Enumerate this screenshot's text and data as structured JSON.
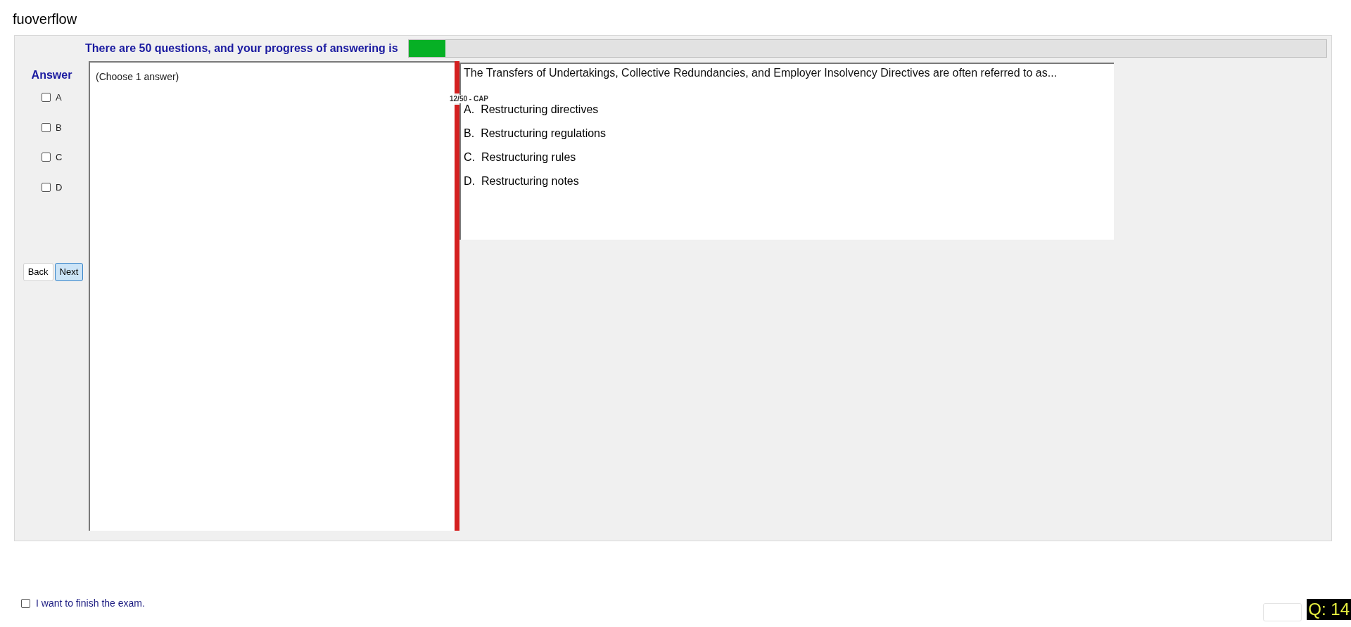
{
  "app_title": "fuoverflow",
  "progress": {
    "label": "There are 50 questions, and your progress of answering is",
    "level": 0.04
  },
  "answer_panel": {
    "title": "Answer",
    "options": [
      {
        "label": "A",
        "checked": false
      },
      {
        "label": "B",
        "checked": false
      },
      {
        "label": "C",
        "checked": false
      },
      {
        "label": "D",
        "checked": false
      }
    ]
  },
  "buttons": [
    {
      "label": "Back",
      "selected": false
    },
    {
      "label": "Next",
      "selected": true
    }
  ],
  "answer_hint": "(Choose 1 answer)",
  "question": {
    "tag": "12/50 - CAP",
    "text": "The Transfers of Undertakings, Collective Redundancies, and Employer Insolvency Directives are often referred to as...",
    "choices": [
      {
        "letter": "A.",
        "text": "Restructuring directives"
      },
      {
        "letter": "B.",
        "text": "Restructuring regulations"
      },
      {
        "letter": "C.",
        "text": "Restructuring rules"
      },
      {
        "letter": "D.",
        "text": "Restructuring notes"
      }
    ]
  },
  "finish": {
    "label": "I want to finish the exam.",
    "checked": false
  },
  "question_counter": "Q: 14"
}
